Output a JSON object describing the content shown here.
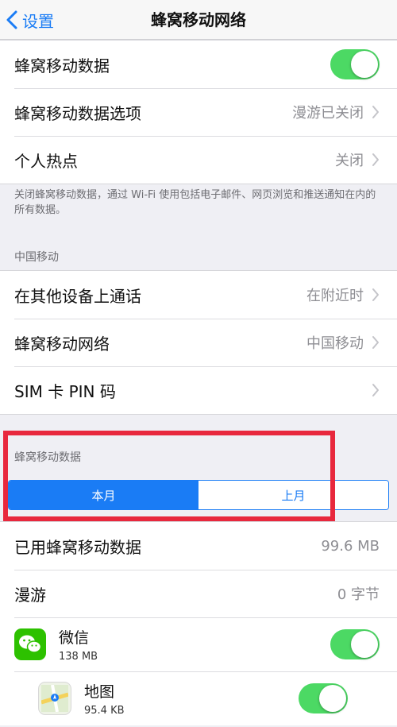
{
  "nav": {
    "back_label": "设置",
    "title": "蜂窝移动网络"
  },
  "group1": {
    "cellular_data": {
      "label": "蜂窝移动数据",
      "enabled": true
    },
    "data_options": {
      "label": "蜂窝移动数据选项",
      "value": "漫游已关闭"
    },
    "hotspot": {
      "label": "个人热点",
      "value": "关闭"
    }
  },
  "footnote": "关闭蜂窝移动数据，通过 Wi-Fi 使用包括电子邮件、网页浏览和推送通知在内的所有数据。",
  "carrier_header": "中国移动",
  "group2": {
    "calls_other_devices": {
      "label": "在其他设备上通话",
      "value": "在附近时"
    },
    "cellular_network": {
      "label": "蜂窝移动网络",
      "value": "中国移动"
    },
    "sim_pin": {
      "label": "SIM 卡 PIN 码"
    }
  },
  "usage_header": "蜂窝移动数据",
  "period_tabs": {
    "current": "本月",
    "last": "上月"
  },
  "group3": {
    "used_data": {
      "label": "已用蜂窝移动数据",
      "value": "99.6 MB"
    },
    "roaming": {
      "label": "漫游",
      "value": "0 字节"
    },
    "apps": [
      {
        "name": "微信",
        "size": "138 MB",
        "icon": "wechat-icon",
        "enabled": true
      },
      {
        "name": "地图",
        "size": "95.4 KB",
        "icon": "maps-icon",
        "enabled": true
      }
    ]
  },
  "colors": {
    "accent": "#1a7cf5",
    "toggle_on": "#4cd964",
    "highlight": "#e8283d"
  }
}
